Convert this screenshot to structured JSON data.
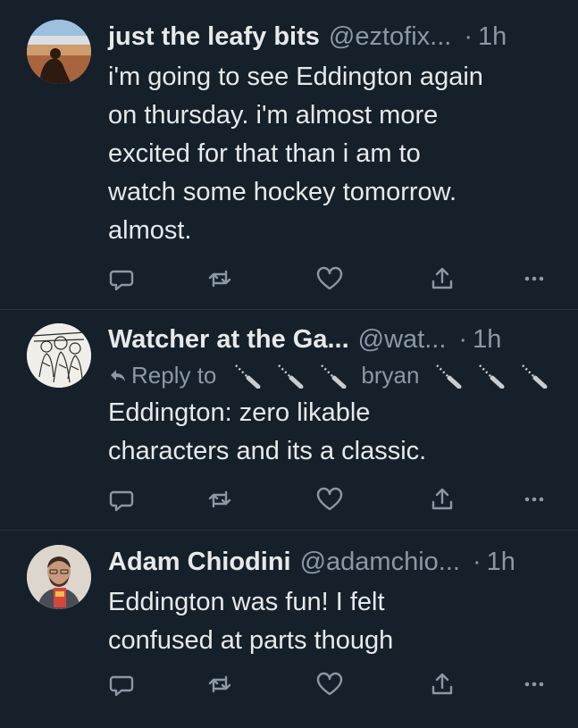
{
  "tweets": [
    {
      "name": "just the leafy bits",
      "handle": "@eztofix...",
      "dot": "·",
      "time": "1h",
      "lines": [
        "i'm going to see Eddington again",
        "on thursday. i'm almost more",
        "excited for that than i am to",
        "watch some hockey tomorrow.",
        "almost."
      ]
    },
    {
      "name": "Watcher at the Ga...",
      "handle": "@wat...",
      "dot": "·",
      "time": "1h",
      "reply_prefix": "Reply to",
      "reply_user": "bryan",
      "lines": [
        "Eddington: zero likable",
        "characters and its a classic."
      ]
    },
    {
      "name": "Adam Chiodini",
      "handle": "@adamchio...",
      "dot": "·",
      "time": "1h",
      "lines": [
        "Eddington was fun! I felt",
        "confused at parts though"
      ]
    }
  ],
  "colors": {
    "background": "#15202b",
    "text": "#e7e9ea",
    "secondary": "#8b98a5",
    "divider": "#2f3336"
  },
  "icons": [
    "reply-icon",
    "retweet-icon",
    "like-icon",
    "share-icon",
    "more-icon",
    "knife-emoji"
  ]
}
